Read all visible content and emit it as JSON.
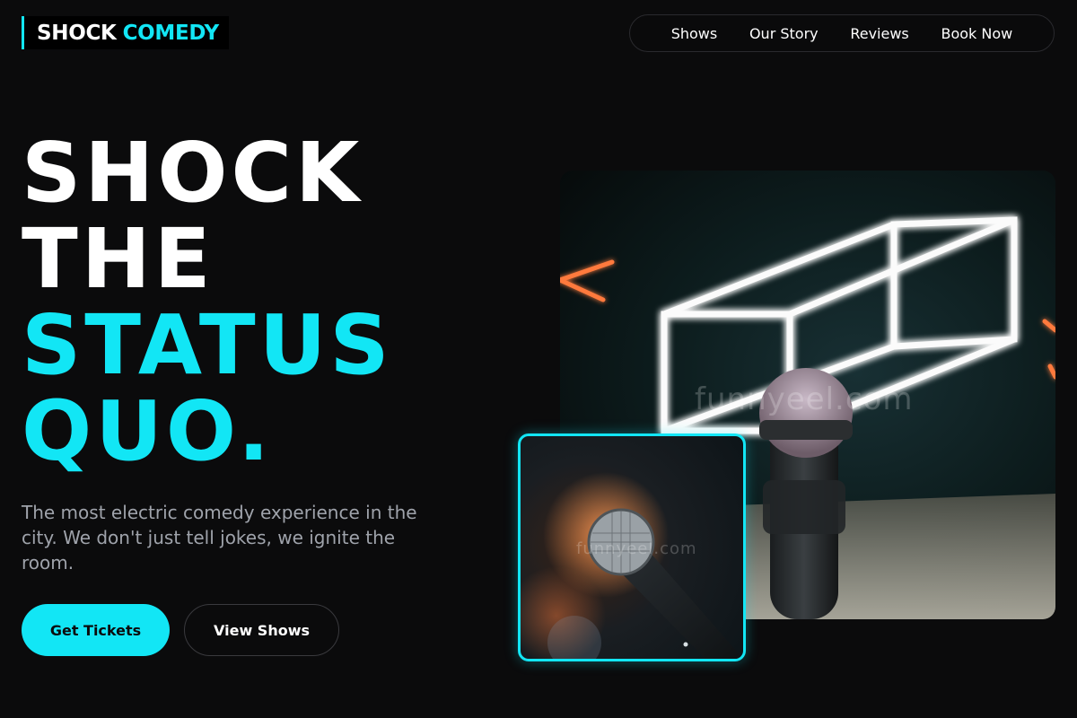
{
  "brand": {
    "name_part1": "SHOCK",
    "name_part2": "COMEDY"
  },
  "nav": {
    "items": [
      {
        "label": "Shows"
      },
      {
        "label": "Our Story"
      },
      {
        "label": "Reviews"
      },
      {
        "label": "Book Now"
      }
    ]
  },
  "hero": {
    "title_line1": "SHOCK",
    "title_line2": "THE",
    "title_line3": "STATUS",
    "title_line4": "QUO.",
    "description": "The most electric comedy experience in the city. We don't just tell jokes, we ignite the room.",
    "primary_button": "Get Tickets",
    "secondary_button": "View Shows"
  },
  "images": {
    "main_watermark": "funnyeel.com",
    "small_watermark": "funnyeel.com"
  },
  "colors": {
    "accent": "#12e6f5",
    "background": "#0b0b0c",
    "text_muted": "#9fa3ab"
  }
}
